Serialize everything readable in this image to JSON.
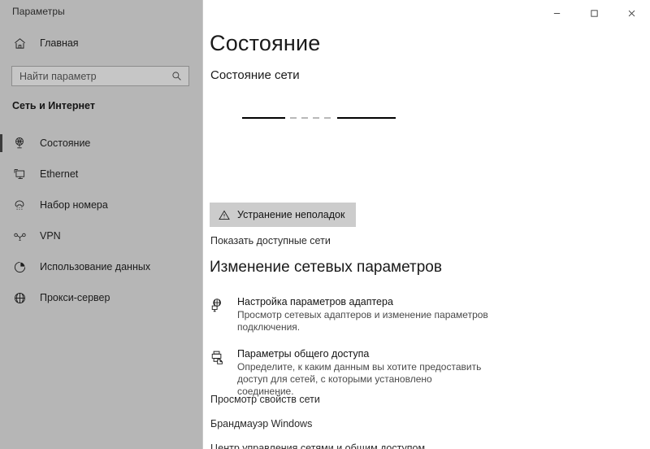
{
  "window": {
    "app_title": "Параметры",
    "controls": [
      {
        "name": "minimize",
        "glyph": "minimize-icon",
        "label": "Свернуть"
      },
      {
        "name": "maximize",
        "glyph": "maximize-icon",
        "label": "Развернуть"
      },
      {
        "name": "close",
        "glyph": "close-icon",
        "label": "Закрыть"
      }
    ]
  },
  "sidebar": {
    "home_label": "Главная",
    "home_icon": "home-icon",
    "search": {
      "placeholder": "Найти параметр",
      "value": "",
      "icon": "search-icon"
    },
    "group_header": "Сеть и Интернет",
    "items": [
      {
        "label": "Состояние",
        "icon": "network-status-icon",
        "selected": true
      },
      {
        "label": "Ethernet",
        "icon": "ethernet-icon",
        "selected": false
      },
      {
        "label": "Набор номера",
        "icon": "dialup-phone-icon",
        "selected": false
      },
      {
        "label": "VPN",
        "icon": "vpn-key-icon",
        "selected": false
      },
      {
        "label": "Использование данных",
        "icon": "data-usage-pie-icon",
        "selected": false
      },
      {
        "label": "Прокси-сервер",
        "icon": "globe-proxy-icon",
        "selected": false
      }
    ]
  },
  "main": {
    "page_title": "Состояние",
    "network_status_heading": "Состояние сети",
    "network_diagram": {
      "state": "partially-loaded",
      "description": "Линии соединения без значков"
    },
    "troubleshoot_button": {
      "label": "Устранение неполадок",
      "icon": "warning-triangle-icon"
    },
    "show_networks_link": "Показать доступные сети",
    "change_settings_heading": "Изменение сетевых параметров",
    "settings": [
      {
        "icon": "adapter-globe-monitor-icon",
        "title": "Настройка параметров адаптера",
        "desc": "Просмотр сетевых адаптеров и изменение параметров подключения."
      },
      {
        "icon": "sharing-printer-folder-icon",
        "title": "Параметры общего доступа",
        "desc": "Определите, к каким данным вы хотите предоставить доступ для сетей, с которыми установлено соединение."
      }
    ],
    "links": [
      "Просмотр свойств сети",
      "Брандмауэр Windows",
      "Центр управления сетями и общим доступом"
    ]
  },
  "colors": {
    "sidebar_bg": "#b6b6b6",
    "content_bg": "#ffffff",
    "selection_bar": "#3b3b3b",
    "button_bg": "#cccccc",
    "text_primary": "#141414",
    "text_secondary": "#4a4a4a"
  }
}
